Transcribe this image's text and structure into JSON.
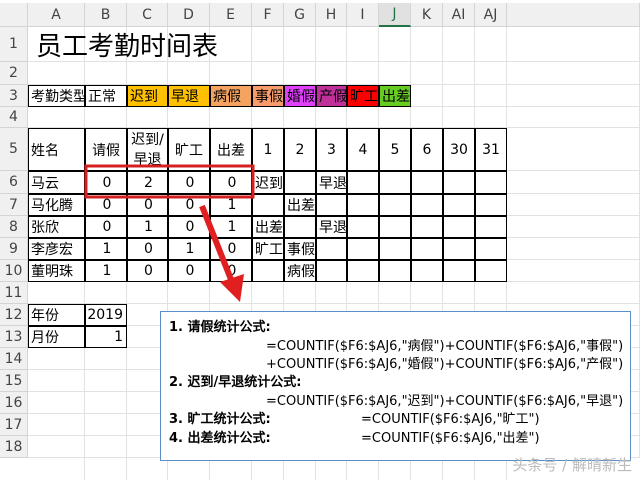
{
  "columns": [
    "A",
    "B",
    "C",
    "D",
    "E",
    "F",
    "G",
    "H",
    "I",
    "J",
    "K",
    "AI",
    "AJ"
  ],
  "selected_column": "J",
  "rows": [
    "1",
    "2",
    "3",
    "4",
    "5",
    "6",
    "7",
    "8",
    "9",
    "10",
    "11",
    "12",
    "13",
    "14",
    "15",
    "16",
    "17",
    "18"
  ],
  "title": "员工考勤时间表",
  "legend": {
    "label": "考勤类型",
    "items": [
      {
        "text": "正常",
        "color": "#ffffff"
      },
      {
        "text": "迟到",
        "color": "#ffc000"
      },
      {
        "text": "早退",
        "color": "#ffc000"
      },
      {
        "text": "病假",
        "color": "#f4a460"
      },
      {
        "text": "事假",
        "color": "#f79c6a"
      },
      {
        "text": "婚假",
        "color": "#e040fb"
      },
      {
        "text": "产假",
        "color": "#c0309a"
      },
      {
        "text": "旷工",
        "color": "#ff0000"
      },
      {
        "text": "出差",
        "color": "#66cc22"
      }
    ]
  },
  "table": {
    "headers": [
      "姓名",
      "请假",
      "迟到/早退",
      "旷工",
      "出差",
      "1",
      "2",
      "3",
      "4",
      "5",
      "6",
      "30",
      "31"
    ],
    "rows": [
      [
        "马云",
        "0",
        "2",
        "0",
        "0",
        "迟到",
        "",
        "早退",
        "",
        "",
        "",
        "",
        ""
      ],
      [
        "马化腾",
        "0",
        "0",
        "0",
        "1",
        "",
        "出差",
        "",
        "",
        "",
        "",
        "",
        ""
      ],
      [
        "张欣",
        "0",
        "1",
        "0",
        "1",
        "出差",
        "",
        "早退",
        "",
        "",
        "",
        "",
        ""
      ],
      [
        "李彦宏",
        "1",
        "0",
        "1",
        "0",
        "旷工",
        "事假",
        "",
        "",
        "",
        "",
        "",
        ""
      ],
      [
        "董明珠",
        "1",
        "0",
        "0",
        "0",
        "",
        "病假",
        "",
        "",
        "",
        "",
        "",
        ""
      ]
    ]
  },
  "year": {
    "label": "年份",
    "value": "2019"
  },
  "month": {
    "label": "月份",
    "value": "1"
  },
  "formulas": {
    "f1_title": "1. 请假统计公式:",
    "f1_line1": "=COUNTIF($F6:$AJ6,\"病假\")+COUNTIF($F6:$AJ6,\"事假\")",
    "f1_line2": "+COUNTIF($F6:$AJ6,\"婚假\")+COUNTIF($F6:$AJ6,\"产假\")",
    "f2_title": "2. 迟到/早退统计公式:",
    "f2_line1": "=COUNTIF($F6:$AJ6,\"迟到\")+COUNTIF($F6:$AJ6,\"早退\")",
    "f3_title": "3. 旷工统计公式:",
    "f3_line": "=COUNTIF($F6:$AJ6,\"旷工\")",
    "f4_title": "4. 出差统计公式:",
    "f4_line": "=COUNTIF($F6:$AJ6,\"出差\")"
  },
  "watermark": "头条号 / 解晴新生",
  "colors": {
    "highlight": "#d42020",
    "box_border": "#5b8fc9"
  }
}
